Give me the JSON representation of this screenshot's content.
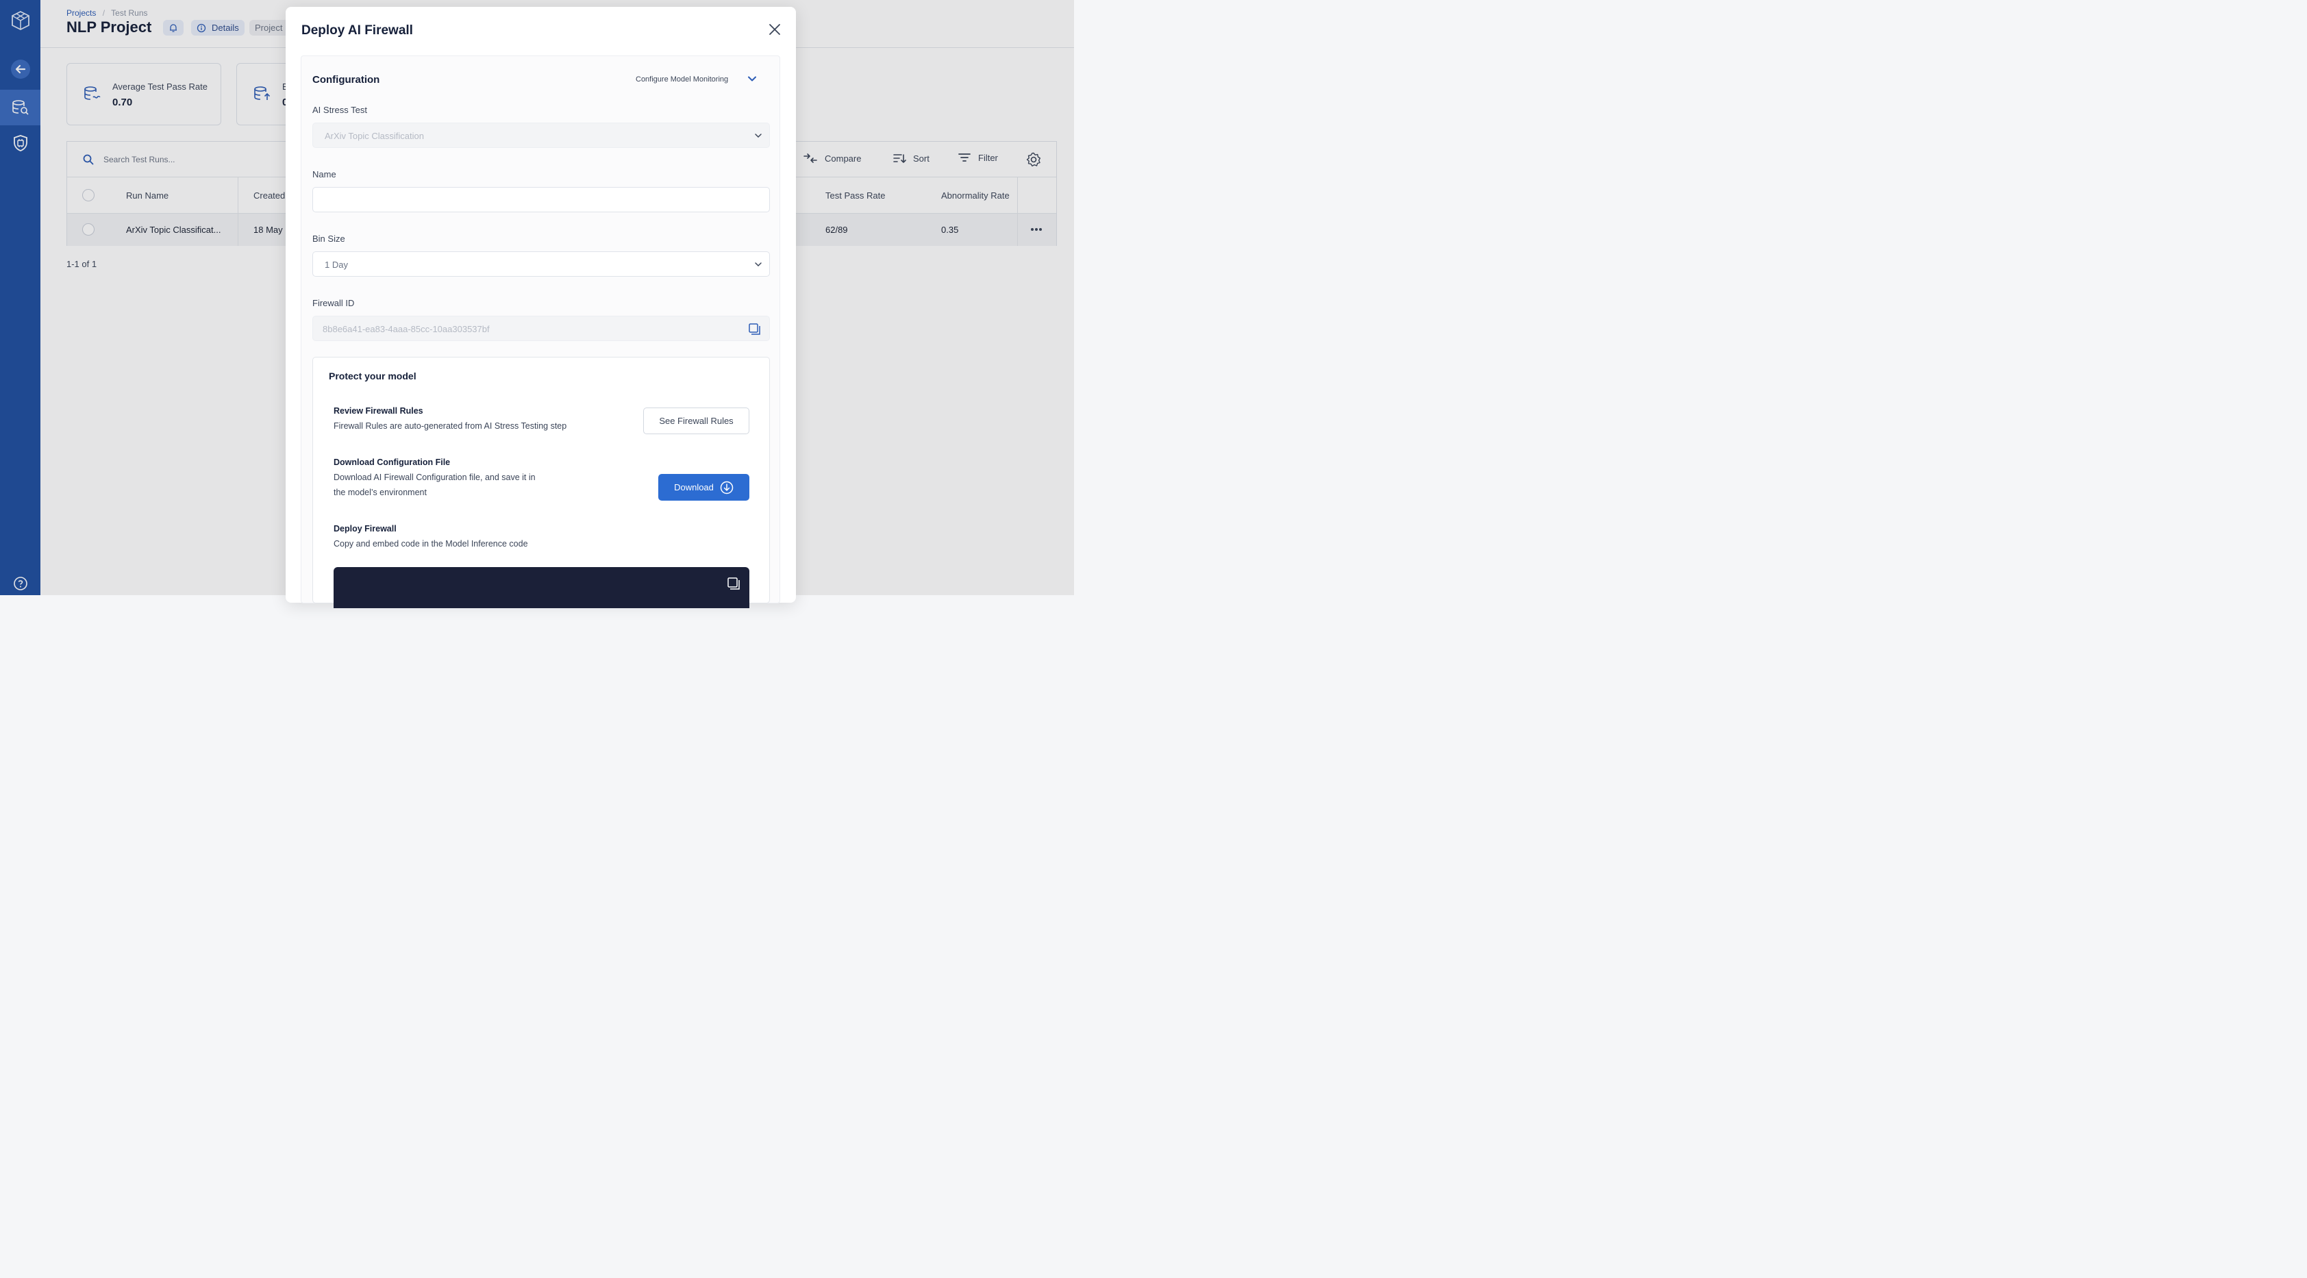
{
  "breadcrumb": {
    "projects": "Projects",
    "separator": "/",
    "current": "Test Runs"
  },
  "header": {
    "title": "NLP Project",
    "details_label": "Details",
    "project_info_label": "Project I"
  },
  "stats": [
    {
      "label": "Average Test Pass Rate",
      "value": "0.70"
    },
    {
      "label": "B",
      "value": "0"
    }
  ],
  "toolbar": {
    "search_placeholder": "Search Test Runs...",
    "compare": "Compare",
    "sort": "Sort",
    "filter": "Filter"
  },
  "table": {
    "columns": {
      "run_name": "Run Name",
      "created": "Created",
      "test_pass_rate": "Test Pass Rate",
      "abnormality_rate": "Abnormality Rate"
    },
    "rows": [
      {
        "run_name": "ArXiv Topic Classificat...",
        "created": "18 May",
        "test_pass_rate": "62/89",
        "abnormality_rate": "0.35"
      }
    ],
    "pager": "1-1 of 1"
  },
  "modal": {
    "title": "Deploy AI Firewall",
    "configuration": {
      "title": "Configuration",
      "configure_monitoring": "Configure Model Monitoring",
      "stress_test_label": "AI Stress Test",
      "stress_test_value": "ArXiv Topic Classification",
      "name_label": "Name",
      "name_value": "",
      "bin_size_label": "Bin Size",
      "bin_size_value": "1 Day",
      "firewall_id_label": "Firewall ID",
      "firewall_id_value": "8b8e6a41-ea83-4aaa-85cc-10aa303537bf"
    },
    "protect": {
      "title": "Protect your model",
      "review_title": "Review Firewall Rules",
      "review_desc": "Firewall Rules are auto-generated from AI Stress Testing step",
      "review_button": "See Firewall Rules",
      "download_title": "Download Configuration File",
      "download_desc_1": "Download AI Firewall Configuration file, and save it in",
      "download_desc_2": "the model’s environment",
      "download_button": "Download",
      "deploy_title": "Deploy Firewall",
      "deploy_desc": "Copy and embed code in the Model Inference code"
    }
  },
  "colors": {
    "sidebar": "#1f4fa0",
    "sidebar_active": "#3b6cc0",
    "primary": "#2c6cd2",
    "code_bg": "#1b2038"
  }
}
